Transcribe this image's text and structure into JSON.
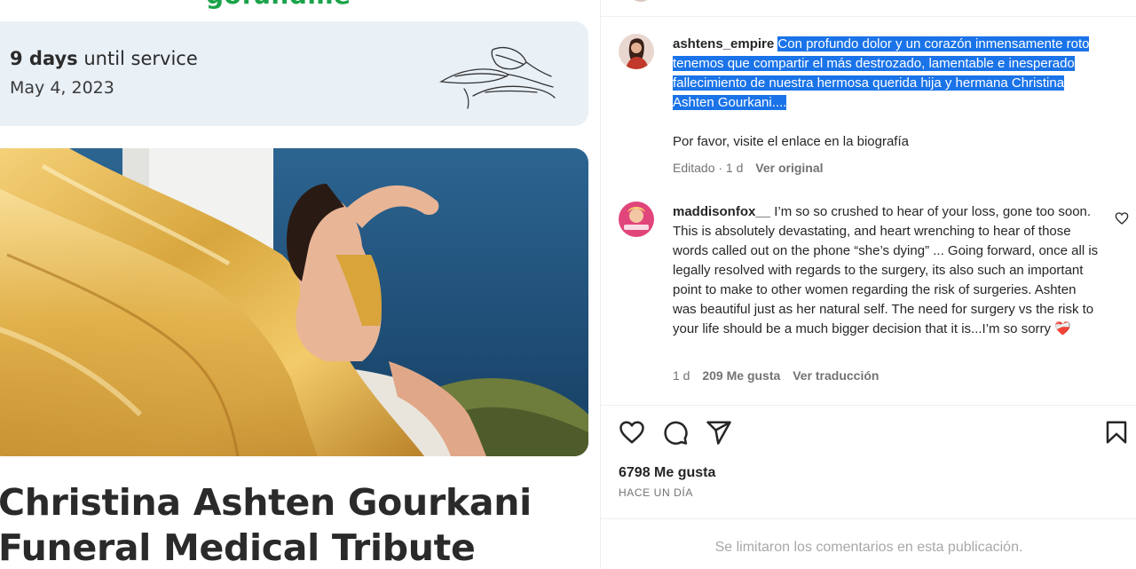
{
  "left": {
    "brand_partial": "gofundme",
    "service": {
      "days_bold": "9 days",
      "days_rest": " until service",
      "date": "May 4, 2023"
    },
    "title_line1": "Christina Ashten Gourkani",
    "title_line2": "Funeral Medical Tribute"
  },
  "post": {
    "author": {
      "username": "ashtens_empire",
      "caption_highlighted": "Con profundo dolor y un corazón inmensamente roto tenemos que compartir el más destrozado, lamentable e inesperado fallecimiento de nuestra hermosa querida hija y hermana Christina Ashten Gourkani....",
      "caption_extra": "Por favor, visite el enlace en la biografía",
      "meta_edited": "Editado · 1 d",
      "meta_see_original": "Ver original"
    },
    "comments": [
      {
        "username": "maddisonfox__",
        "text": "I’m so so crushed to hear of your loss, gone too soon. This is absolutely devastating, and heart wrenching to hear of those words called out on the phone “she’s dying” ... Going forward, once all is legally resolved with regards to the surgery, its also such an important point to make to other women regarding the risk of surgeries. Ashten was beautiful just as her natural self. The need for surgery vs the risk to your life should be a much bigger decision that it is...I’m so sorry",
        "emoji": "❤️‍🩹",
        "time": "1 d",
        "likes": "209 Me gusta",
        "translate": "Ver traducción"
      }
    ],
    "likes_count": "6798 Me gusta",
    "timestamp": "HACE UN DÍA",
    "comments_limited": "Se limitaron los comentarios en esta publicación."
  },
  "icons": {
    "like": "heart-icon",
    "comment": "comment-icon",
    "share": "send-icon",
    "save": "bookmark-icon"
  },
  "colors": {
    "highlight": "#1a73e8",
    "muted": "#737373",
    "gold": "#d9a43a",
    "sea": "#1f4f7a",
    "card": "#e9f0f6"
  }
}
